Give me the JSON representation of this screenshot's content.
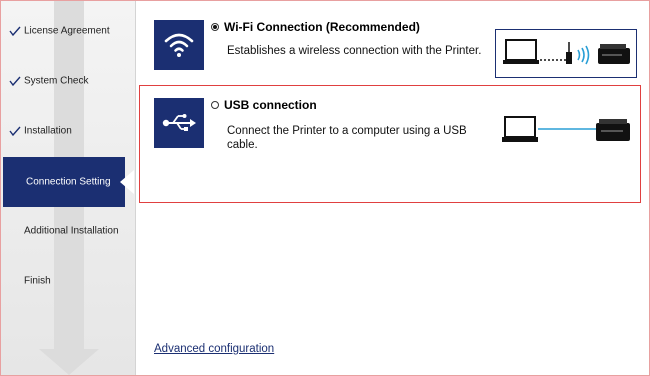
{
  "sidebar": {
    "steps": [
      {
        "label": "License Agreement",
        "completed": true
      },
      {
        "label": "System Check",
        "completed": true
      },
      {
        "label": "Installation",
        "completed": true
      },
      {
        "label": "Connection Setting",
        "active": true
      },
      {
        "label": "Additional Installation",
        "completed": false
      },
      {
        "label": "Finish",
        "completed": false
      }
    ]
  },
  "options": {
    "wifi": {
      "title": "Wi-Fi Connection (Recommended)",
      "description": "Establishes a wireless connection with the Printer.",
      "selected": true,
      "icon": "wifi-icon"
    },
    "usb": {
      "title": "USB connection",
      "description": "Connect the Printer to a computer using a USB cable.",
      "selected": false,
      "icon": "usb-icon"
    }
  },
  "advanced_link": "Advanced configuration",
  "colors": {
    "accent": "#1b2f72",
    "highlight_border": "#e04040",
    "usb_cable": "#2a9fd6"
  }
}
